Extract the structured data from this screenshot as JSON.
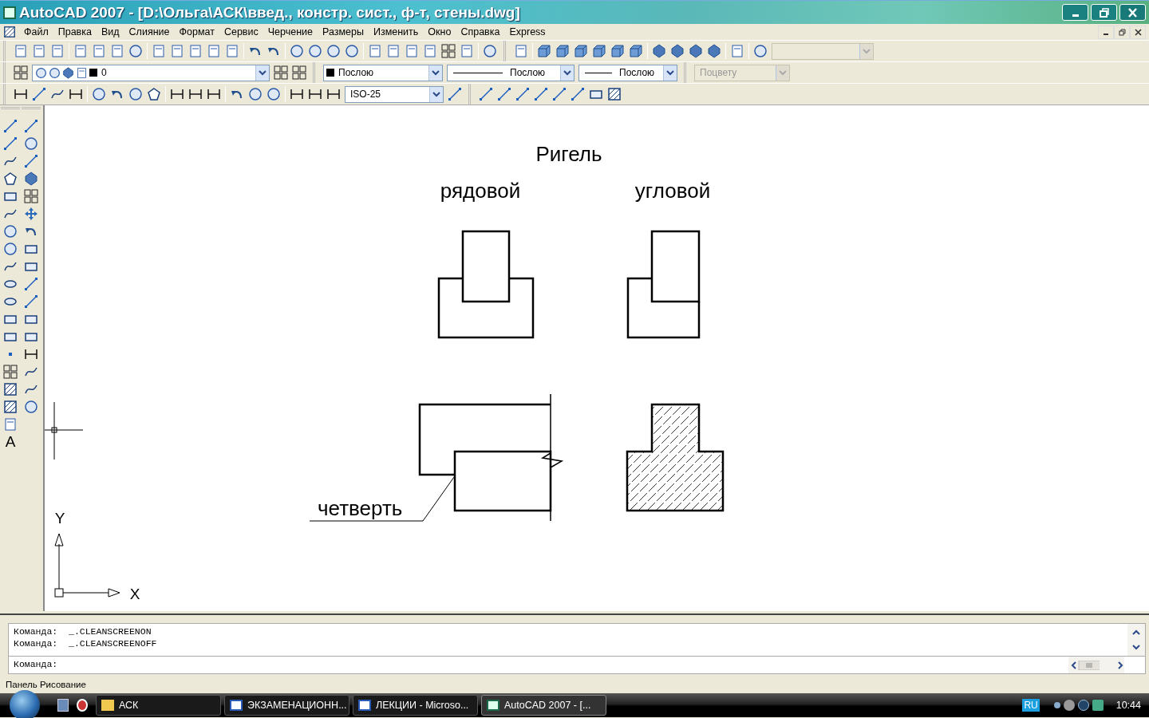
{
  "window": {
    "title": "AutoCAD 2007 - [D:\\Ольга\\АСК\\введ., констр. сист.,  ф-т, стены.dwg]"
  },
  "menu": [
    "Файл",
    "Правка",
    "Вид",
    "Слияние",
    "Формат",
    "Сервис",
    "Черчение",
    "Размеры",
    "Изменить",
    "Окно",
    "Справка",
    "Express"
  ],
  "toolbars": {
    "views_dropdown": {
      "disabled": true
    },
    "layer": {
      "value": "0"
    },
    "color": {
      "value": "Послою"
    },
    "linetype": {
      "value": "Послою"
    },
    "lineweight": {
      "value": "Послою"
    },
    "plot_style": {
      "value": "Поцвету",
      "disabled": true
    },
    "dim_style": {
      "value": "ISO-25"
    }
  },
  "draw_toolbar": {
    "text_tool": "A"
  },
  "drawing": {
    "title": "Ригель",
    "labels": [
      "рядовой",
      "угловой"
    ],
    "callout": "четверть",
    "axis_y": "Y",
    "axis_x": "X"
  },
  "command_line": {
    "history": [
      "Команда:  _.CLEANSCREENON",
      "Команда:  _.CLEANSCREENOFF"
    ],
    "prompt": "Команда:"
  },
  "status_bar": {
    "text": "Панель Рисование"
  },
  "taskbar": {
    "tasks": [
      {
        "label": "АСК",
        "kind": "folder",
        "selected": false
      },
      {
        "label": "ЭКЗАМЕНАЦИОНН...",
        "kind": "word",
        "selected": false
      },
      {
        "label": "ЛЕКЦИИ - Microso...",
        "kind": "word",
        "selected": false
      },
      {
        "label": "AutoCAD 2007 - [...",
        "kind": "autocad",
        "selected": true
      }
    ],
    "language": "RU",
    "clock": "10:44"
  }
}
